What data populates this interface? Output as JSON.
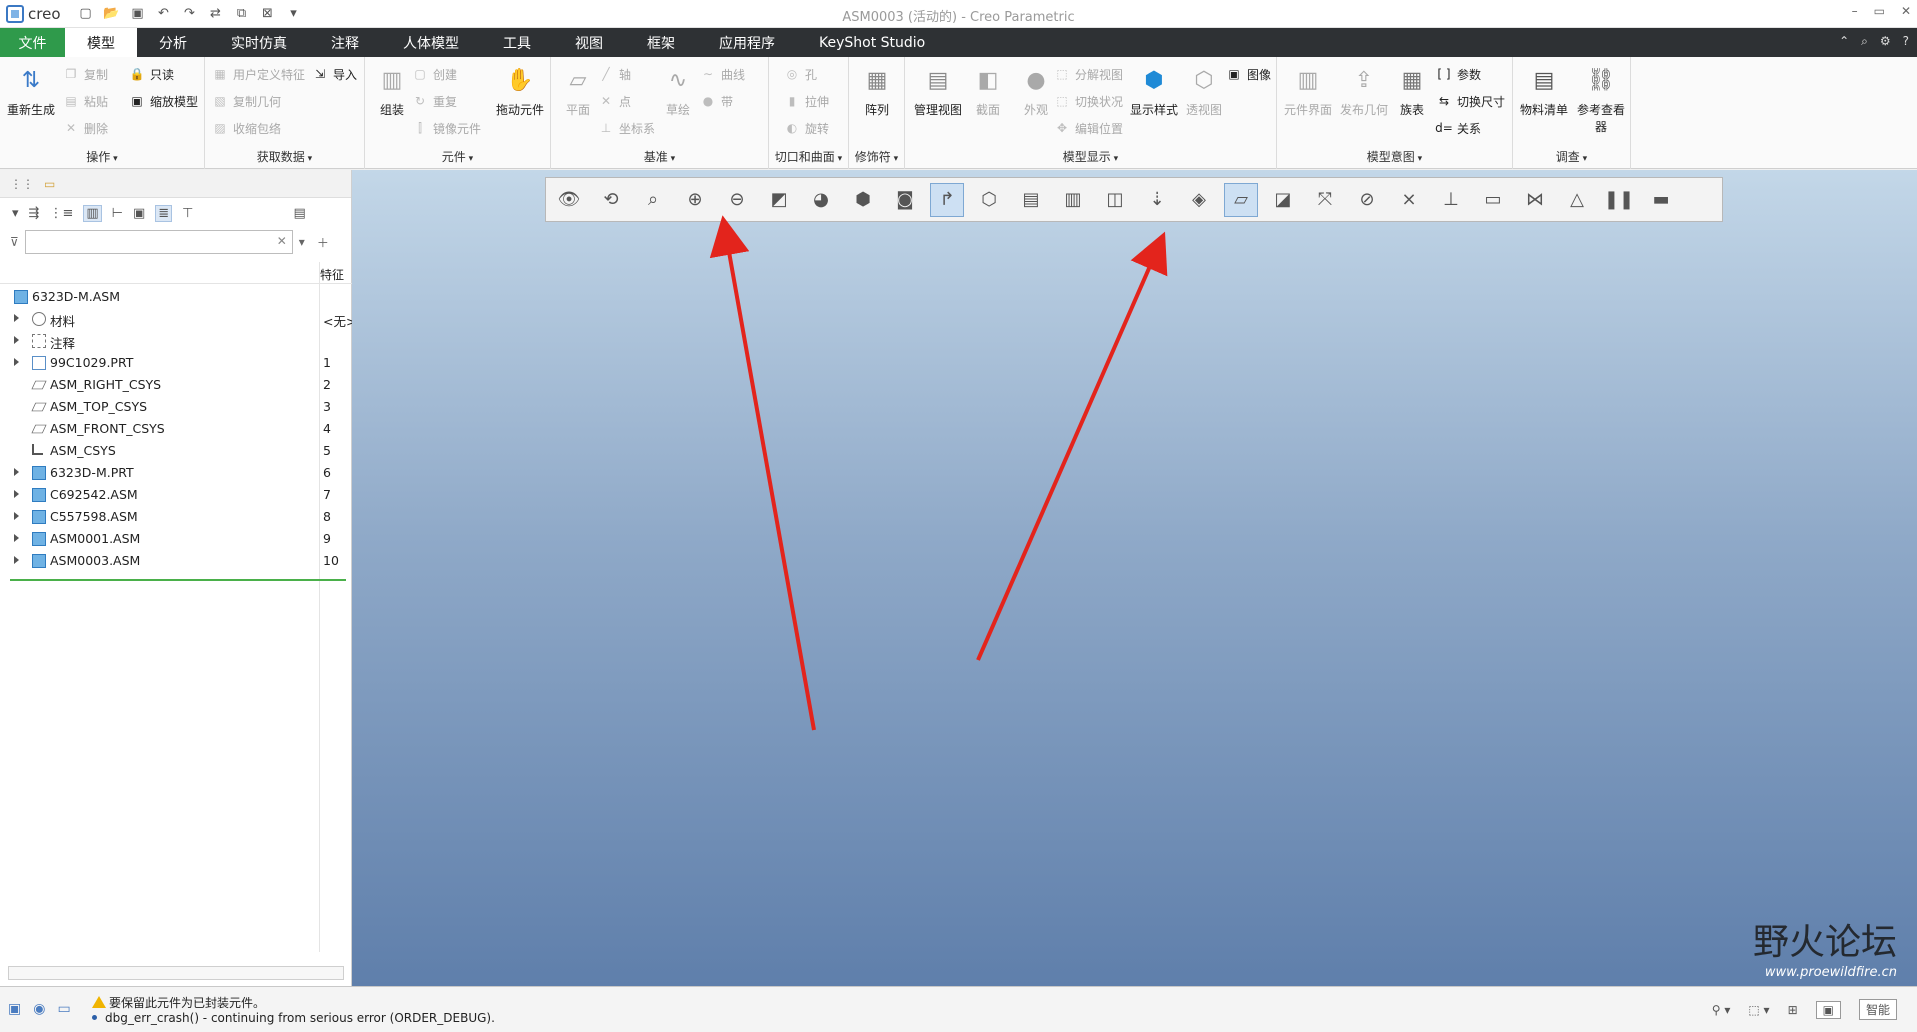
{
  "window": {
    "app_logo": "creo",
    "title": "ASM0003 (活动的) - Creo Parametric",
    "controls": [
      "–",
      "▭",
      "✕"
    ]
  },
  "qat_icons": [
    "new-icon",
    "open-icon",
    "save-icon",
    "undo-icon",
    "redo-icon",
    "regenerate-icon",
    "windows-icon",
    "close-window-icon",
    "customize-icon"
  ],
  "tabs": [
    {
      "label": "文件",
      "kind": "file"
    },
    {
      "label": "模型",
      "kind": "active"
    },
    {
      "label": "分析"
    },
    {
      "label": "实时仿真"
    },
    {
      "label": "注释"
    },
    {
      "label": "人体模型"
    },
    {
      "label": "工具"
    },
    {
      "label": "视图"
    },
    {
      "label": "框架"
    },
    {
      "label": "应用程序"
    },
    {
      "label": "KeyShot Studio"
    }
  ],
  "ribbon": {
    "groups": {
      "operations": {
        "label": "操作",
        "regenerate": "重新生成",
        "copy": "复制",
        "paste": "粘贴",
        "delete": "删除",
        "readonly": "只读",
        "shrinkwrap_model": "缩放模型"
      },
      "get_data": {
        "label": "获取数据",
        "udf": "用户定义特征",
        "copy_geom": "复制几何",
        "shrinkwrap": "收缩包络",
        "import": "导入"
      },
      "component": {
        "label": "元件",
        "assemble": "组装",
        "create": "创建",
        "repeat": "重复",
        "mirror": "镜像元件",
        "drag": "拖动元件"
      },
      "datum": {
        "label": "基准",
        "plane": "平面",
        "axis": "轴",
        "point": "点",
        "csys": "坐标系",
        "sketch": "草绘",
        "curve": "曲线",
        "ribbon": "带"
      },
      "cut_surface": {
        "label": "切口和曲面",
        "hole": "孔",
        "extrude": "拉伸",
        "revolve": "旋转"
      },
      "modifiers": {
        "label": "修饰符",
        "pattern": "阵列"
      },
      "model_display": {
        "label": "模型显示",
        "manage_views": "管理视图",
        "section": "截面",
        "appearance": "外观",
        "explode": "分解视图",
        "toggle_status": "切换状况",
        "edit_position": "编辑位置",
        "display_style": "显示样式",
        "perspective": "透视图",
        "image": "图像"
      },
      "model_intent": {
        "label": "模型意图",
        "component_interface": "元件界面",
        "publish_geom": "发布几何",
        "family_table": "族表",
        "params": "参数",
        "switch_dims": "切换尺寸",
        "relations": "关系"
      },
      "investigate": {
        "label": "调查",
        "bom": "物料清单",
        "ref_viewer": "参考查看器"
      }
    }
  },
  "model_tree": {
    "filter_placeholder": "",
    "column_header": "特征",
    "rows": [
      {
        "name": "6323D-M.ASM",
        "num": "",
        "icon": "asm",
        "level": 0,
        "expand": false
      },
      {
        "name": "材料",
        "num": "<无>",
        "icon": "mat",
        "level": 1,
        "expand": true
      },
      {
        "name": "注释",
        "num": "",
        "icon": "note",
        "level": 1,
        "expand": true
      },
      {
        "name": "99C1029.PRT",
        "num": "1",
        "icon": "prt",
        "level": 1,
        "expand": true
      },
      {
        "name": "ASM_RIGHT_CSYS",
        "num": "2",
        "icon": "plane",
        "level": 1,
        "expand": false
      },
      {
        "name": "ASM_TOP_CSYS",
        "num": "3",
        "icon": "plane",
        "level": 1,
        "expand": false
      },
      {
        "name": "ASM_FRONT_CSYS",
        "num": "4",
        "icon": "plane",
        "level": 1,
        "expand": false
      },
      {
        "name": "ASM_CSYS",
        "num": "5",
        "icon": "csys",
        "level": 1,
        "expand": false
      },
      {
        "name": "6323D-M.PRT",
        "num": "6",
        "icon": "asm",
        "level": 1,
        "expand": true
      },
      {
        "name": "C692542.ASM",
        "num": "7",
        "icon": "asm",
        "level": 1,
        "expand": true
      },
      {
        "name": "C557598.ASM",
        "num": "8",
        "icon": "asm",
        "level": 1,
        "expand": true
      },
      {
        "name": "ASM0001.ASM",
        "num": "9",
        "icon": "asm",
        "level": 1,
        "expand": true
      },
      {
        "name": "ASM0003.ASM",
        "num": "10",
        "icon": "asm",
        "level": 1,
        "expand": true
      }
    ]
  },
  "graphics_toolbar": {
    "icons": [
      "refit-view-icon",
      "reorient-icon",
      "zoom-box-icon",
      "zoom-in-icon",
      "zoom-out-icon",
      "repaint-icon",
      "shading-icon",
      "standard-orientation-icon",
      "saved-views-icon",
      "view-manager-icon",
      "section-icon",
      "named-view-icon",
      "layers-icon",
      "explode-icon",
      "move-icon",
      "perspective-icon",
      "display-plane-icon",
      "plane-tag-icon",
      "axis-display-icon",
      "point-display-icon",
      "csys-display-icon",
      "annotation-icon",
      "spin-center-icon",
      "tangent-icon",
      "flexible-icon",
      "pause-icon",
      "pipe-icon"
    ],
    "active_index": [
      9,
      16
    ]
  },
  "watermark": {
    "cn": "野火论坛",
    "url": "www.proewildfire.cn"
  },
  "status": {
    "message1": "要保留此元件为已封装元件。",
    "message2": "dbg_err_crash() - continuing from serious error (ORDER_DEBUG).",
    "filter_label": "智能"
  }
}
